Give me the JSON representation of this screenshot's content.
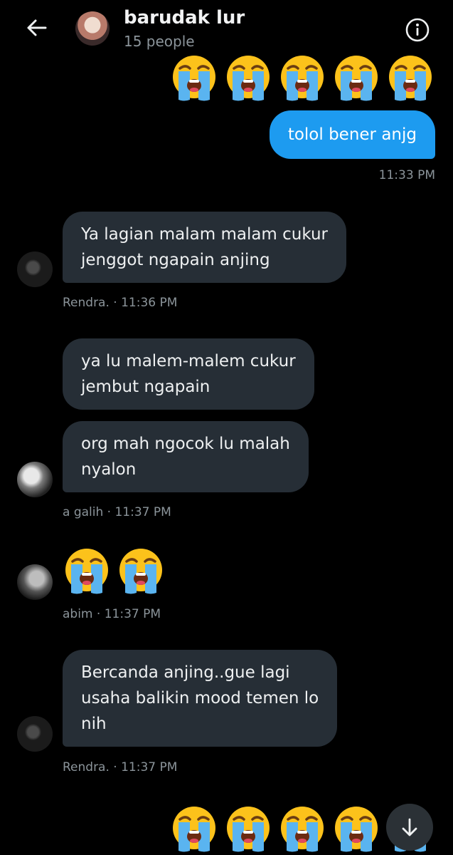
{
  "header": {
    "title": "barudak lur",
    "subtitle": "15 people"
  },
  "messages": {
    "out_text": "tolol bener anjg",
    "out_time": "11:33 PM",
    "m1_text_l1": "Ya lagian malam malam cukur",
    "m1_text_l2": "jenggot ngapain anjing",
    "m1_meta": "Rendra. · 11:36 PM",
    "m2_text_l1": "ya lu malem-malem cukur",
    "m2_text_l2": "jembut ngapain",
    "m3_text_l1": "org mah ngocok lu malah",
    "m3_text_l2": "nyalon",
    "m3_meta": "a galih · 11:37 PM",
    "m4_meta": "abim · 11:37 PM",
    "m5_text_l1": "Bercanda anjing..gue lagi",
    "m5_text_l2": "usaha balikin mood temen lo",
    "m5_text_l3": "nih",
    "m5_meta": "Rendra. · 11:37 PM"
  },
  "emoji": {
    "name": "loudly-crying-face",
    "top_row_count": 5,
    "abim_count": 2,
    "bottom_row_count": 5
  },
  "colors": {
    "accent": "#1d9bf0",
    "incoming_bubble": "#262e36",
    "background": "#000000",
    "meta": "#8b949a"
  }
}
